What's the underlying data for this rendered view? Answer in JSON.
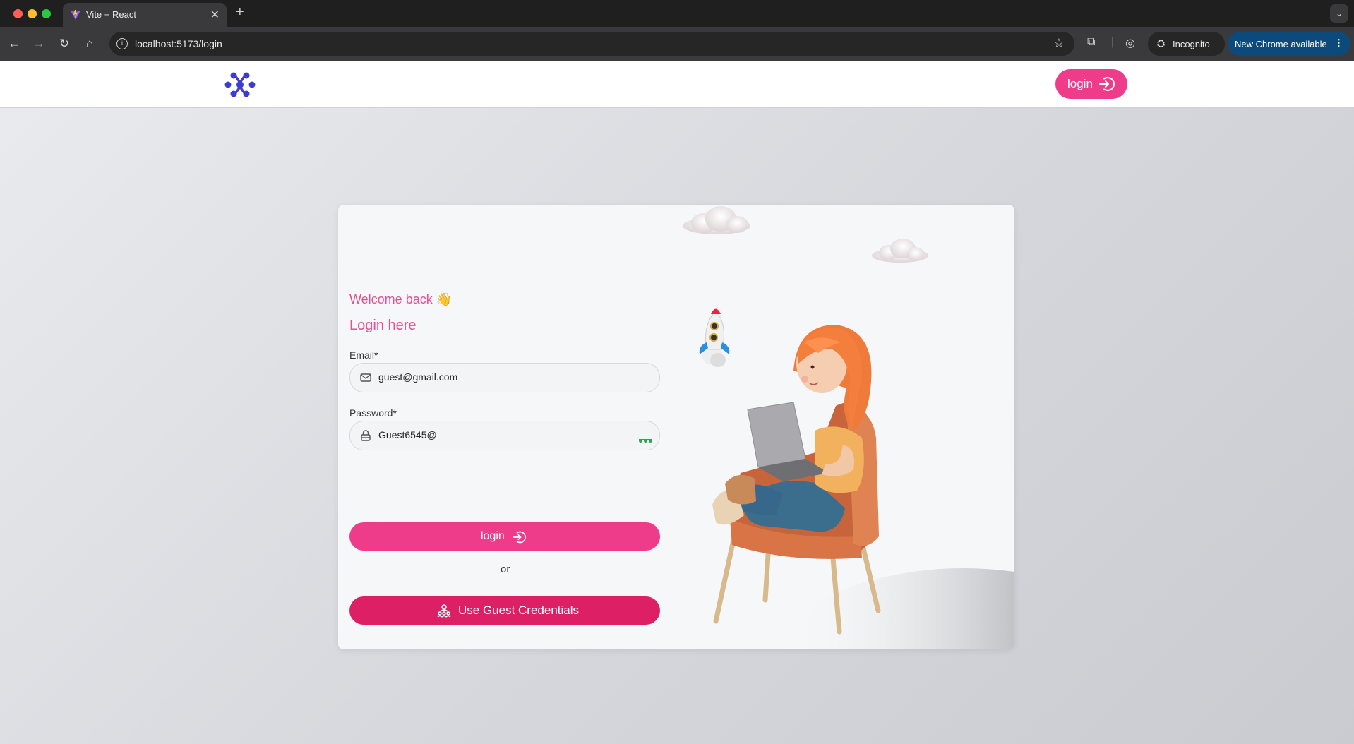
{
  "browser": {
    "tab_title": "Vite + React",
    "url": "localhost:5173/login",
    "incognito_label": "Incognito",
    "update_label": "New Chrome available"
  },
  "navbar": {
    "login_label": "login",
    "brand_color": "#3e3bd1"
  },
  "form": {
    "welcome": "Welcome back 👋",
    "heading": "Login here",
    "email_label": "Email*",
    "email_value": "guest@gmail.com",
    "password_label": "Password*",
    "password_value": "Guest6545@",
    "login_button": "login",
    "separator": "or",
    "guest_button": "Use Guest Credentials"
  },
  "colors": {
    "accent": "#ee3b8a",
    "guest_button": "#dd2066",
    "heading": "#e94d92",
    "password_manager": "#1faa4e"
  },
  "icons": [
    "mail-icon",
    "lock-icon",
    "password-manager-icon",
    "login-arrow-icon",
    "users-icon",
    "brand-logo-icon"
  ]
}
